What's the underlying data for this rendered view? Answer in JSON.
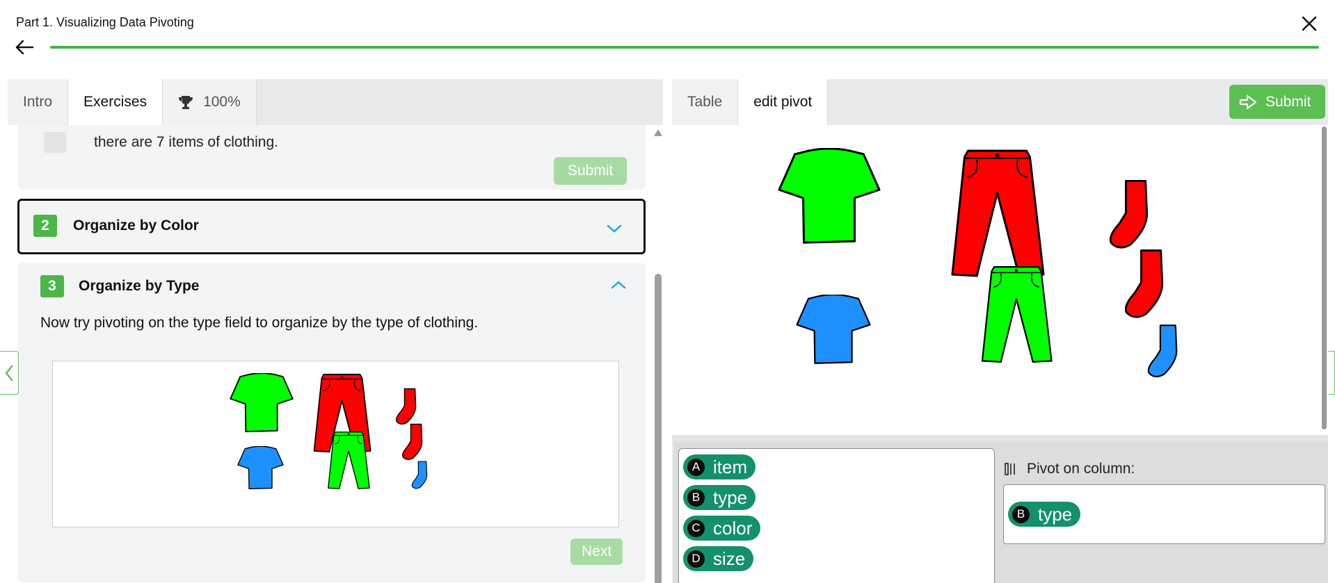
{
  "header": {
    "title": "Part 1. Visualizing Data Pivoting",
    "progress_percent": 100,
    "progress_color": "#3fb54a"
  },
  "left": {
    "tabs": [
      {
        "label": "Intro"
      },
      {
        "label": "Exercises"
      },
      {
        "label": "100%",
        "icon": "trophy-icon"
      }
    ],
    "card1": {
      "text": "there are 7 items of clothing.",
      "submit_label": "Submit"
    },
    "card2": {
      "number": "2",
      "title": "Organize by Color"
    },
    "card3": {
      "number": "3",
      "title": "Organize by Type",
      "description": "Now try pivoting on the type field to organize by the type of clothing.",
      "next_label": "Next"
    }
  },
  "right": {
    "tabs": [
      {
        "label": "Table"
      },
      {
        "label": "edit pivot"
      }
    ],
    "submit_label": "Submit",
    "fields": [
      {
        "letter": "A",
        "name": "item"
      },
      {
        "letter": "B",
        "name": "type"
      },
      {
        "letter": "C",
        "name": "color"
      },
      {
        "letter": "D",
        "name": "size"
      }
    ],
    "pivot_label": "Pivot on column:",
    "pivot_value": {
      "letter": "B",
      "name": "type"
    }
  },
  "colors": {
    "accent_green": "#5cbf52",
    "pill_green": "#14906a",
    "shirt_green": "#00ff00",
    "shirt_blue": "#1e90ff",
    "pants_red": "#ff0000"
  }
}
